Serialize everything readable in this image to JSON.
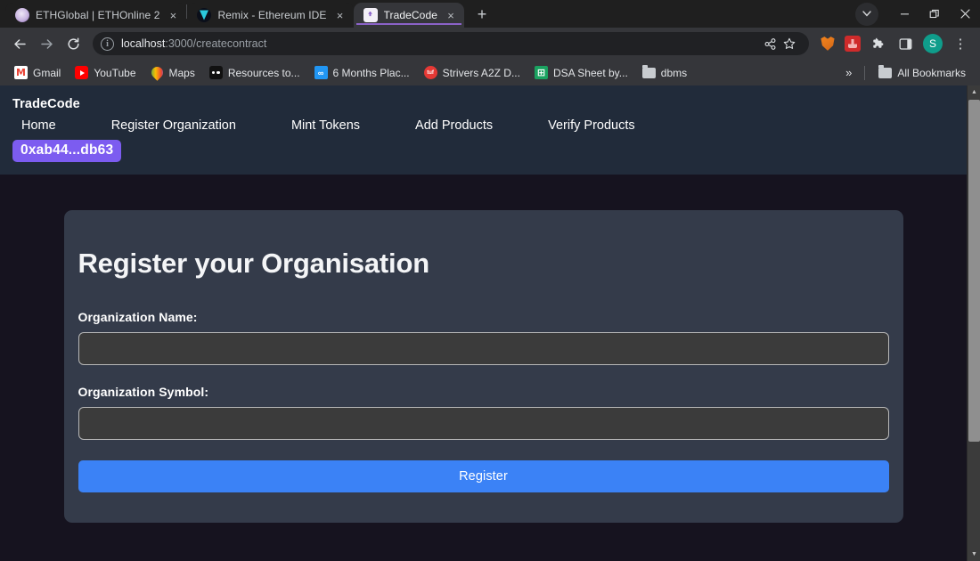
{
  "browser": {
    "tabs": [
      {
        "title": "ETHGlobal | ETHOnline 2",
        "favicon": "ethglobal-icon",
        "active": false
      },
      {
        "title": "Remix - Ethereum IDE",
        "favicon": "remix-icon",
        "active": false
      },
      {
        "title": "TradeCode",
        "favicon": "tradecode-icon",
        "active": true
      }
    ],
    "new_tab_label": "+",
    "close_label": "×",
    "window_controls": {
      "tab_search": "⌄",
      "minimize": "—",
      "maximize": "❐",
      "close": "✕"
    },
    "toolbar": {
      "back": "←",
      "forward": "→",
      "reload": "↻",
      "site_info_icon": "i",
      "url_host": "localhost",
      "url_path": ":3000/createcontract",
      "share": "share-icon",
      "bookmark_star": "☆",
      "extensions": [
        "metamask-extension-icon",
        "red-extension-icon"
      ],
      "puzzle": "❖",
      "side_panel": "▣",
      "profile_initial": "S",
      "menu": "⋮"
    },
    "bookmarks": [
      {
        "label": "Gmail",
        "icon": "gmail-icon"
      },
      {
        "label": "YouTube",
        "icon": "youtube-icon"
      },
      {
        "label": "Maps",
        "icon": "maps-icon"
      },
      {
        "label": "Resources to...",
        "icon": "dots-icon"
      },
      {
        "label": "6 Months Plac...",
        "icon": "infinity-icon"
      },
      {
        "label": "Strivers A2Z D...",
        "icon": "takeuforward-icon"
      },
      {
        "label": "DSA Sheet by...",
        "icon": "sheet-icon"
      },
      {
        "label": "dbms",
        "icon": "folder-icon"
      }
    ],
    "bookmarks_overflow": "»",
    "all_bookmarks_label": "All Bookmarks",
    "all_bookmarks_icon": "folder-icon"
  },
  "page": {
    "navbar": {
      "brand": "TradeCode",
      "links": [
        {
          "label": "Home"
        },
        {
          "label": "Register Organization"
        },
        {
          "label": "Mint Tokens"
        },
        {
          "label": "Add Products"
        },
        {
          "label": "Verify Products"
        }
      ],
      "wallet_address": "0xab44...db63"
    },
    "form": {
      "title": "Register your Organisation",
      "fields": [
        {
          "label": "Organization Name:",
          "value": "",
          "placeholder": ""
        },
        {
          "label": "Organization Symbol:",
          "value": "",
          "placeholder": ""
        }
      ],
      "submit_label": "Register"
    }
  },
  "colors": {
    "navbar_bg": "#212b3a",
    "page_bg": "#16131f",
    "card_bg": "#343b4a",
    "accent_button": "#3b82f6",
    "wallet_badge": "#7c5cf0"
  }
}
